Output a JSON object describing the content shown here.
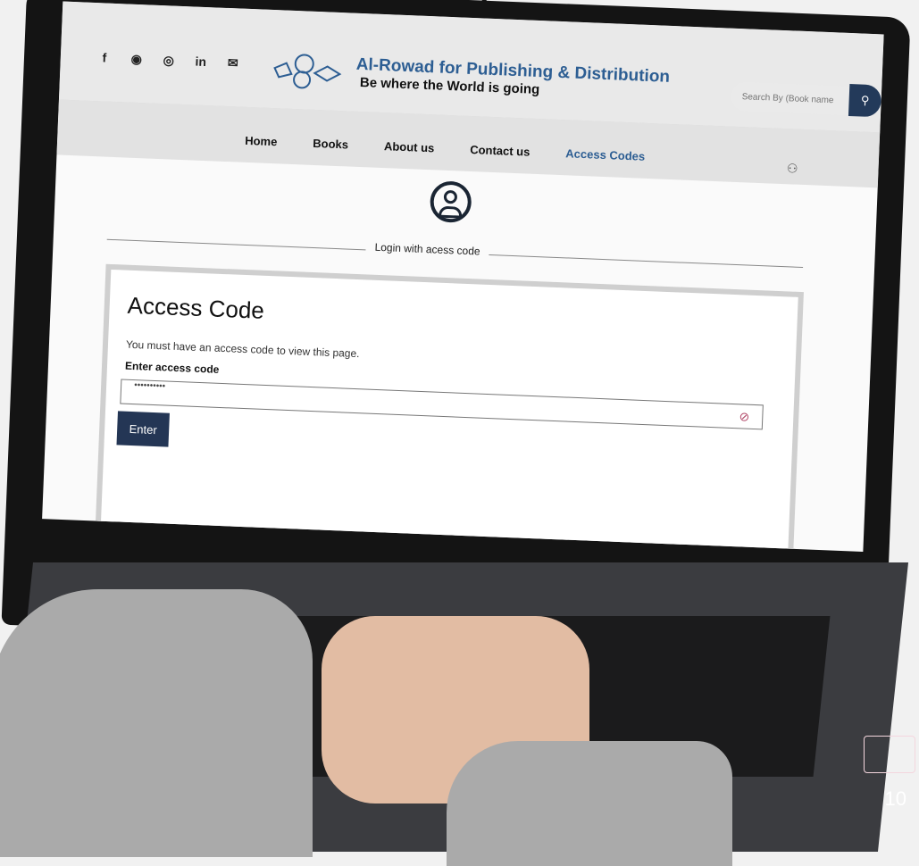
{
  "header": {
    "social_icons": [
      "facebook-icon",
      "messenger-icon",
      "instagram-icon",
      "linkedin-icon",
      "mail-icon"
    ],
    "brand_name": "Al-Rowad for Publishing & Distribution",
    "tagline": "Be where the World is going",
    "search": {
      "placeholder": "Search By (Book name"
    }
  },
  "nav": {
    "items": [
      {
        "label": "Home"
      },
      {
        "label": "Books"
      },
      {
        "label": "About us"
      },
      {
        "label": "Contact us"
      },
      {
        "label": "Access Codes"
      }
    ]
  },
  "login": {
    "divider_label": "Login with acess code",
    "title": "Access Code",
    "description": "You must have an access code to view this page.",
    "field_label": "Enter access code",
    "field_value": "••••••••••",
    "submit_label": "Enter"
  },
  "colors": {
    "accent": "#2d5e93",
    "button": "#243655",
    "eye_icon": "#b24a6a"
  },
  "page_number": "10"
}
